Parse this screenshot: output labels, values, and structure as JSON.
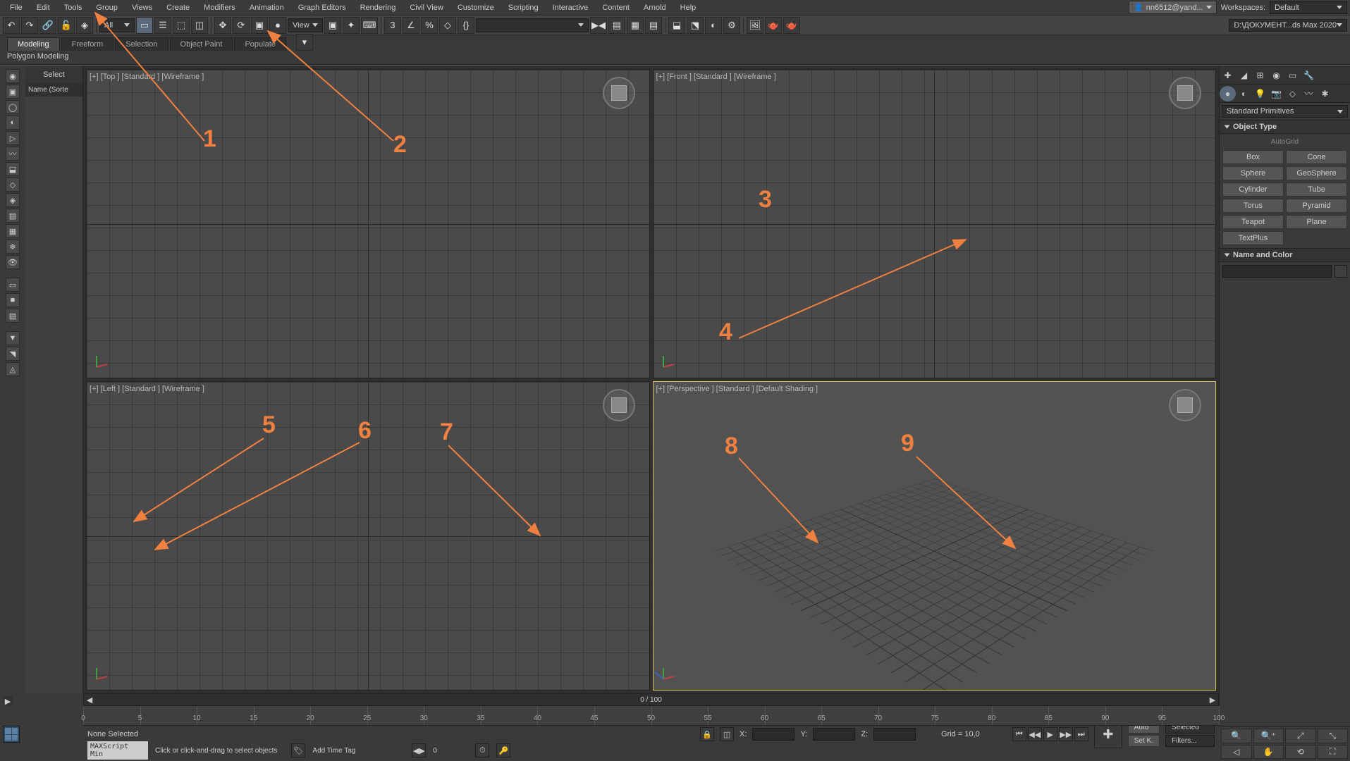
{
  "menubar": [
    "File",
    "Edit",
    "Tools",
    "Group",
    "Views",
    "Create",
    "Modifiers",
    "Animation",
    "Graph Editors",
    "Rendering",
    "Civil View",
    "Customize",
    "Scripting",
    "Interactive",
    "Content",
    "Arnold",
    "Help"
  ],
  "user": "nn6512@yand...",
  "workspaces_label": "Workspaces:",
  "workspace": "Default",
  "toolbar": {
    "filter_dd": "All",
    "view_dd": "View"
  },
  "project_file": "D:\\ДОКУМЕНТ...ds Max 2020",
  "ribbon_tabs": [
    "Modeling",
    "Freeform",
    "Selection",
    "Object Paint",
    "Populate"
  ],
  "ribbon_active": "Polygon Modeling",
  "scene_panel": {
    "title": "Select",
    "col": "Name (Sorte"
  },
  "viewports": [
    {
      "label": "[+] [Top ] [Standard ] [Wireframe ]"
    },
    {
      "label": "[+] [Front ] [Standard ] [Wireframe ]"
    },
    {
      "label": "[+] [Left ] [Standard ] [Wireframe ]"
    },
    {
      "label": "[+] [Perspective ] [Standard ] [Default Shading ]"
    }
  ],
  "annotations": [
    "1",
    "2",
    "3",
    "4",
    "5",
    "6",
    "7",
    "8",
    "9"
  ],
  "command_panel": {
    "category": "Standard Primitives",
    "rollout1": "Object Type",
    "autogrid": "AutoGrid",
    "buttons": [
      "Box",
      "Cone",
      "Sphere",
      "GeoSphere",
      "Cylinder",
      "Tube",
      "Torus",
      "Pyramid",
      "Teapot",
      "Plane",
      "TextPlus"
    ],
    "rollout2": "Name and Color"
  },
  "time": {
    "frame_label": "0 / 100",
    "ticks": [
      0,
      5,
      10,
      15,
      20,
      25,
      30,
      35,
      40,
      45,
      50,
      55,
      60,
      65,
      70,
      75,
      80,
      85,
      90,
      95,
      100
    ]
  },
  "status": {
    "selection": "None Selected",
    "prompt": "Click or click-and-drag to select objects",
    "maxscript": "MAXScript Min",
    "x": "X:",
    "y": "Y:",
    "z": "Z:",
    "grid": "Grid = 10,0",
    "addtag": "Add Time Tag",
    "auto": "Auto",
    "setkey": "Set K.",
    "selected": "Selected",
    "filters": "Filters...",
    "framebox": "0"
  }
}
